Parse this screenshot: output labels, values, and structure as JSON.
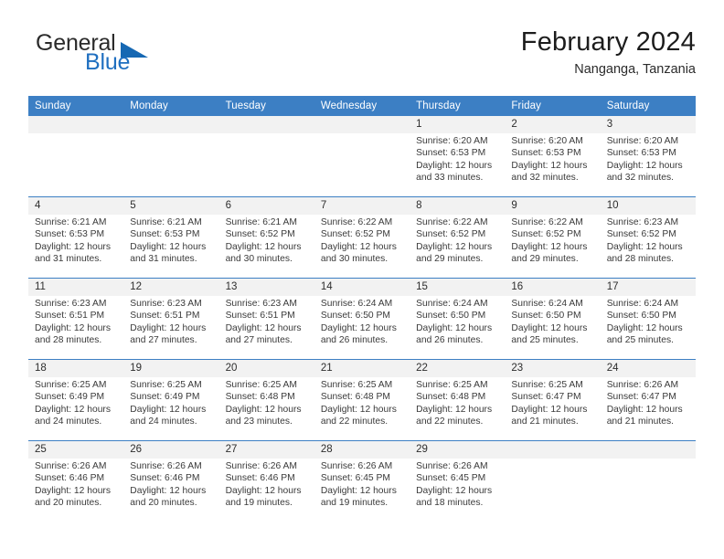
{
  "brand": {
    "name_part1": "General",
    "name_part2": "Blue",
    "logo_icon": "triangle-logo-icon"
  },
  "header": {
    "title": "February 2024",
    "subtitle": "Nanganga, Tanzania"
  },
  "colors": {
    "header_blue": "#3c7fc4",
    "date_strip_gray": "#f2f2f2",
    "brand_blue": "#1f6fc0"
  },
  "calendar": {
    "weekday_headers": [
      "Sunday",
      "Monday",
      "Tuesday",
      "Wednesday",
      "Thursday",
      "Friday",
      "Saturday"
    ],
    "weeks": [
      [
        {
          "day": "",
          "sunrise": "",
          "sunset": "",
          "daylight": ""
        },
        {
          "day": "",
          "sunrise": "",
          "sunset": "",
          "daylight": ""
        },
        {
          "day": "",
          "sunrise": "",
          "sunset": "",
          "daylight": ""
        },
        {
          "day": "",
          "sunrise": "",
          "sunset": "",
          "daylight": ""
        },
        {
          "day": "1",
          "sunrise": "Sunrise: 6:20 AM",
          "sunset": "Sunset: 6:53 PM",
          "daylight": "Daylight: 12 hours and 33 minutes."
        },
        {
          "day": "2",
          "sunrise": "Sunrise: 6:20 AM",
          "sunset": "Sunset: 6:53 PM",
          "daylight": "Daylight: 12 hours and 32 minutes."
        },
        {
          "day": "3",
          "sunrise": "Sunrise: 6:20 AM",
          "sunset": "Sunset: 6:53 PM",
          "daylight": "Daylight: 12 hours and 32 minutes."
        }
      ],
      [
        {
          "day": "4",
          "sunrise": "Sunrise: 6:21 AM",
          "sunset": "Sunset: 6:53 PM",
          "daylight": "Daylight: 12 hours and 31 minutes."
        },
        {
          "day": "5",
          "sunrise": "Sunrise: 6:21 AM",
          "sunset": "Sunset: 6:53 PM",
          "daylight": "Daylight: 12 hours and 31 minutes."
        },
        {
          "day": "6",
          "sunrise": "Sunrise: 6:21 AM",
          "sunset": "Sunset: 6:52 PM",
          "daylight": "Daylight: 12 hours and 30 minutes."
        },
        {
          "day": "7",
          "sunrise": "Sunrise: 6:22 AM",
          "sunset": "Sunset: 6:52 PM",
          "daylight": "Daylight: 12 hours and 30 minutes."
        },
        {
          "day": "8",
          "sunrise": "Sunrise: 6:22 AM",
          "sunset": "Sunset: 6:52 PM",
          "daylight": "Daylight: 12 hours and 29 minutes."
        },
        {
          "day": "9",
          "sunrise": "Sunrise: 6:22 AM",
          "sunset": "Sunset: 6:52 PM",
          "daylight": "Daylight: 12 hours and 29 minutes."
        },
        {
          "day": "10",
          "sunrise": "Sunrise: 6:23 AM",
          "sunset": "Sunset: 6:52 PM",
          "daylight": "Daylight: 12 hours and 28 minutes."
        }
      ],
      [
        {
          "day": "11",
          "sunrise": "Sunrise: 6:23 AM",
          "sunset": "Sunset: 6:51 PM",
          "daylight": "Daylight: 12 hours and 28 minutes."
        },
        {
          "day": "12",
          "sunrise": "Sunrise: 6:23 AM",
          "sunset": "Sunset: 6:51 PM",
          "daylight": "Daylight: 12 hours and 27 minutes."
        },
        {
          "day": "13",
          "sunrise": "Sunrise: 6:23 AM",
          "sunset": "Sunset: 6:51 PM",
          "daylight": "Daylight: 12 hours and 27 minutes."
        },
        {
          "day": "14",
          "sunrise": "Sunrise: 6:24 AM",
          "sunset": "Sunset: 6:50 PM",
          "daylight": "Daylight: 12 hours and 26 minutes."
        },
        {
          "day": "15",
          "sunrise": "Sunrise: 6:24 AM",
          "sunset": "Sunset: 6:50 PM",
          "daylight": "Daylight: 12 hours and 26 minutes."
        },
        {
          "day": "16",
          "sunrise": "Sunrise: 6:24 AM",
          "sunset": "Sunset: 6:50 PM",
          "daylight": "Daylight: 12 hours and 25 minutes."
        },
        {
          "day": "17",
          "sunrise": "Sunrise: 6:24 AM",
          "sunset": "Sunset: 6:50 PM",
          "daylight": "Daylight: 12 hours and 25 minutes."
        }
      ],
      [
        {
          "day": "18",
          "sunrise": "Sunrise: 6:25 AM",
          "sunset": "Sunset: 6:49 PM",
          "daylight": "Daylight: 12 hours and 24 minutes."
        },
        {
          "day": "19",
          "sunrise": "Sunrise: 6:25 AM",
          "sunset": "Sunset: 6:49 PM",
          "daylight": "Daylight: 12 hours and 24 minutes."
        },
        {
          "day": "20",
          "sunrise": "Sunrise: 6:25 AM",
          "sunset": "Sunset: 6:48 PM",
          "daylight": "Daylight: 12 hours and 23 minutes."
        },
        {
          "day": "21",
          "sunrise": "Sunrise: 6:25 AM",
          "sunset": "Sunset: 6:48 PM",
          "daylight": "Daylight: 12 hours and 22 minutes."
        },
        {
          "day": "22",
          "sunrise": "Sunrise: 6:25 AM",
          "sunset": "Sunset: 6:48 PM",
          "daylight": "Daylight: 12 hours and 22 minutes."
        },
        {
          "day": "23",
          "sunrise": "Sunrise: 6:25 AM",
          "sunset": "Sunset: 6:47 PM",
          "daylight": "Daylight: 12 hours and 21 minutes."
        },
        {
          "day": "24",
          "sunrise": "Sunrise: 6:26 AM",
          "sunset": "Sunset: 6:47 PM",
          "daylight": "Daylight: 12 hours and 21 minutes."
        }
      ],
      [
        {
          "day": "25",
          "sunrise": "Sunrise: 6:26 AM",
          "sunset": "Sunset: 6:46 PM",
          "daylight": "Daylight: 12 hours and 20 minutes."
        },
        {
          "day": "26",
          "sunrise": "Sunrise: 6:26 AM",
          "sunset": "Sunset: 6:46 PM",
          "daylight": "Daylight: 12 hours and 20 minutes."
        },
        {
          "day": "27",
          "sunrise": "Sunrise: 6:26 AM",
          "sunset": "Sunset: 6:46 PM",
          "daylight": "Daylight: 12 hours and 19 minutes."
        },
        {
          "day": "28",
          "sunrise": "Sunrise: 6:26 AM",
          "sunset": "Sunset: 6:45 PM",
          "daylight": "Daylight: 12 hours and 19 minutes."
        },
        {
          "day": "29",
          "sunrise": "Sunrise: 6:26 AM",
          "sunset": "Sunset: 6:45 PM",
          "daylight": "Daylight: 12 hours and 18 minutes."
        },
        {
          "day": "",
          "sunrise": "",
          "sunset": "",
          "daylight": ""
        },
        {
          "day": "",
          "sunrise": "",
          "sunset": "",
          "daylight": ""
        }
      ]
    ]
  }
}
